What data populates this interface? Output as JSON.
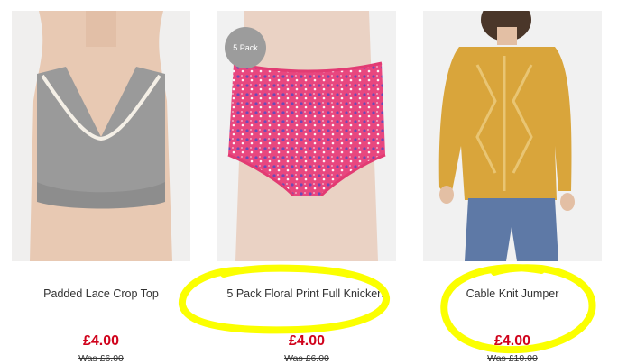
{
  "colors": {
    "price": "#d0021b",
    "highlight": "#fbff00",
    "badge": "#9c9c9c"
  },
  "products": [
    {
      "name": "Padded Lace Crop Top",
      "price": "£4.00",
      "was": "Was £6.00",
      "badge": ""
    },
    {
      "name": "5 Pack Floral Print Full Knickers",
      "price": "£4.00",
      "was": "Was £6.00",
      "badge": "5 Pack"
    },
    {
      "name": "Cable Knit Jumper",
      "price": "£4.00",
      "was": "Was £10.00",
      "badge": ""
    }
  ]
}
